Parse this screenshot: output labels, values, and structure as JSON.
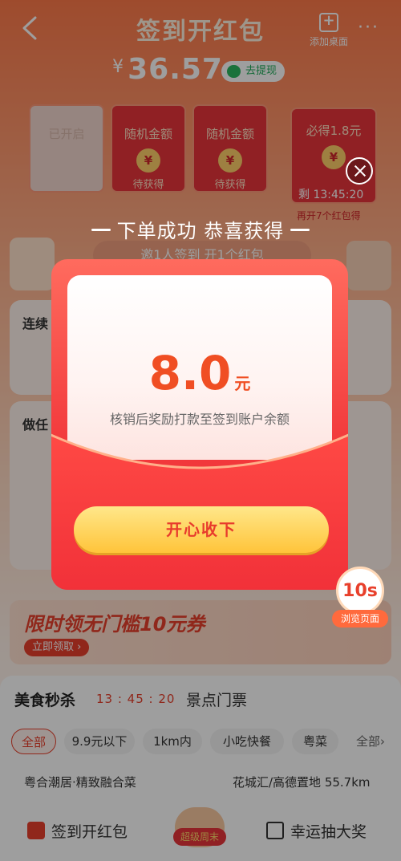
{
  "header": {
    "title": "签到开红包",
    "add_to_desktop": "添加桌面",
    "more": "···"
  },
  "balance": {
    "currency": "¥",
    "amount": "36.57",
    "withdraw_label": "去提现"
  },
  "red_packets": [
    {
      "title": "已开启",
      "status": ""
    },
    {
      "title": "随机金额",
      "status": "待获得"
    },
    {
      "title": "随机金额",
      "status": "待获得"
    }
  ],
  "guaranteed_packet": {
    "title": "必得1.8元",
    "timer": "剩 13:45:20",
    "note": "再开7个红包得"
  },
  "invite": {
    "text": "邀1人签到 开1个红包"
  },
  "task_section": {
    "title": "做任"
  },
  "connect_section": {
    "title": "连续"
  },
  "coupon_banner": {
    "title": "限时领无门槛10元券",
    "button": "立即领取 ›"
  },
  "food": {
    "tab_food": "美食秒杀",
    "timer": "13 : 45 : 20",
    "tab_scenic": "景点门票",
    "chips": [
      "全部",
      "9.9元以下",
      "1km内",
      "小吃快餐",
      "粤菜",
      "全部›"
    ],
    "merchant": "粤合潮居·精致融合菜",
    "location": "花城汇/高德置地 55.7km"
  },
  "bottom_nav": {
    "left": "签到开红包",
    "center": "超级周末",
    "right": "幸运抽大奖"
  },
  "popup": {
    "headline": "下单成功 恭喜获得",
    "amount": "8.0",
    "unit": "元",
    "description": "核销后奖励打款至签到账户余额",
    "accept_button": "开心收下"
  },
  "countdown": {
    "value": "10s",
    "label": "浏览页面"
  },
  "colors": {
    "accent_red": "#f04e23",
    "button_gold": "#ffc43a",
    "envelope_red": "#ee2b36"
  }
}
